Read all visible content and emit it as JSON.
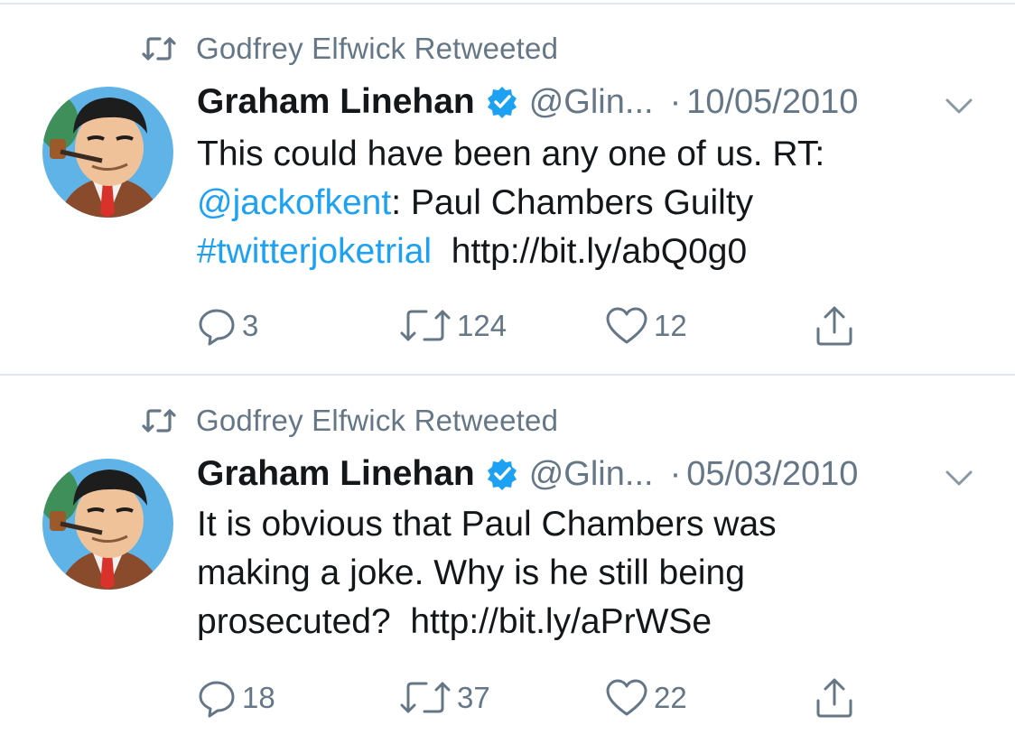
{
  "tweets": [
    {
      "retweeted_by": "Godfrey Elfwick Retweeted",
      "name": "Graham Linehan",
      "handle": "@Glin...",
      "dot": "·",
      "date": "10/05/2010",
      "lines": [
        [
          {
            "t": "This could have been any one of us. RT:",
            "link": false
          }
        ],
        [
          {
            "t": "@jackofkent",
            "link": true
          },
          {
            "t": ": Paul Chambers Guilty",
            "link": false
          }
        ],
        [
          {
            "t": "#twitterjoketrial",
            "link": true
          },
          {
            "t": "  http://bit.ly/abQ0g0",
            "link": false
          }
        ]
      ],
      "replies": "3",
      "retweets": "124",
      "likes": "12"
    },
    {
      "retweeted_by": "Godfrey Elfwick Retweeted",
      "name": "Graham Linehan",
      "handle": "@Glin...",
      "dot": "·",
      "date": "05/03/2010",
      "lines": [
        [
          {
            "t": "It is obvious that Paul Chambers was",
            "link": false
          }
        ],
        [
          {
            "t": "making a joke. Why is he still being",
            "link": false
          }
        ],
        [
          {
            "t": "prosecuted?  http://bit.ly/aPrWSe",
            "link": false
          }
        ]
      ],
      "replies": "18",
      "retweets": "37",
      "likes": "22"
    }
  ],
  "icons": {
    "retweet": "retweet-icon",
    "verified": "verified-badge-icon",
    "caret": "chevron-down-icon",
    "reply": "reply-icon",
    "like": "heart-icon",
    "share": "share-icon"
  },
  "colors": {
    "link": "#1da1f2",
    "muted": "#657786",
    "text": "#14171a",
    "verified": "#1da1f2",
    "divider": "#e1e8ed"
  }
}
